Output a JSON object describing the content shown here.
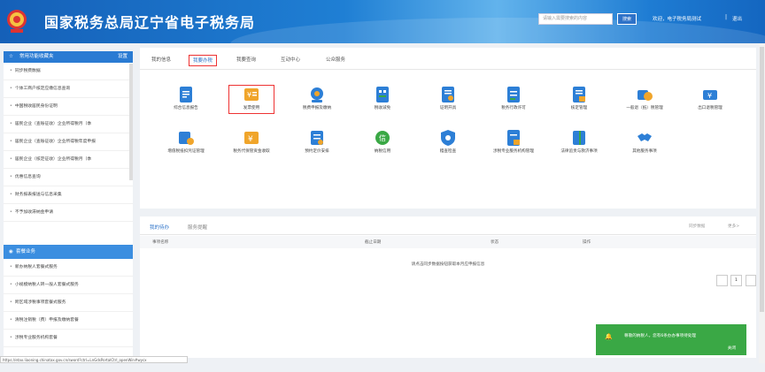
{
  "header": {
    "title": "国家税务总局辽宁省电子税务局",
    "search_placeholder": "请输入需要搜索的内容",
    "search_button": "搜索",
    "welcome": "欢迎，电子税务局测试",
    "separator": "|",
    "logout": "退出"
  },
  "sidebar": {
    "panel1_title": "常用功能收藏夹",
    "panel1_settings": "设置",
    "items": [
      "同步税费数据",
      "个体工商户核定应缴信息查询",
      "中国税收居民身份证明",
      "居民企业（查账征收）企业所得税月（季",
      "居民企业（查账征收）企业所得税年度申报",
      "居民企业（核定征收）企业所得税月（季",
      "优惠信息查询",
      "财务报表报送与信息采集",
      "不予加收滞纳金申请"
    ],
    "panel2_title": "套餐业务",
    "items2": [
      "新办纳税人套餐式服务",
      "小规模纳税人转一般人套餐式服务",
      "跨区域涉税事项套餐式服务",
      "清税注销税（费）申报及缴纳套餐",
      "涉税专业服务机构套餐"
    ]
  },
  "url": "https://etax.liaoning.chinatax.gov.cn/sword?ctrl=LnGdsPortalCtrl_openWin#wycx",
  "tabs": [
    "我的信息",
    "我要办税",
    "我要查询",
    "互动中心",
    "公众服务"
  ],
  "services_row1": [
    "综合信息报告",
    "发票使用",
    "税费申报及缴纳",
    "税收减免",
    "证明开具",
    "税务行政许可",
    "核定管理",
    "一般退（抵）税管理",
    "出口退税管理"
  ],
  "services_row2": [
    "增值税抵扣凭证管理",
    "税务代保管资金收取",
    "预约定价安排",
    "纳税信用",
    "稽查检查",
    "涉税专业服务机构管理",
    "法律追责与救济事项",
    "其他服务事项"
  ],
  "todo": {
    "tab1": "我的待办",
    "tab2": "服务提醒",
    "sync": "同步数据",
    "more": "更多>",
    "col1": "事项名称",
    "col2": "截止日期",
    "col3": "状态",
    "col4": "操作",
    "empty": "请点击同步数据按钮获取本月应申报信息",
    "page": "1"
  },
  "toast": {
    "msg": "尊敬的纳税人，您有6条办办事项待处理",
    "close": "关闭"
  }
}
